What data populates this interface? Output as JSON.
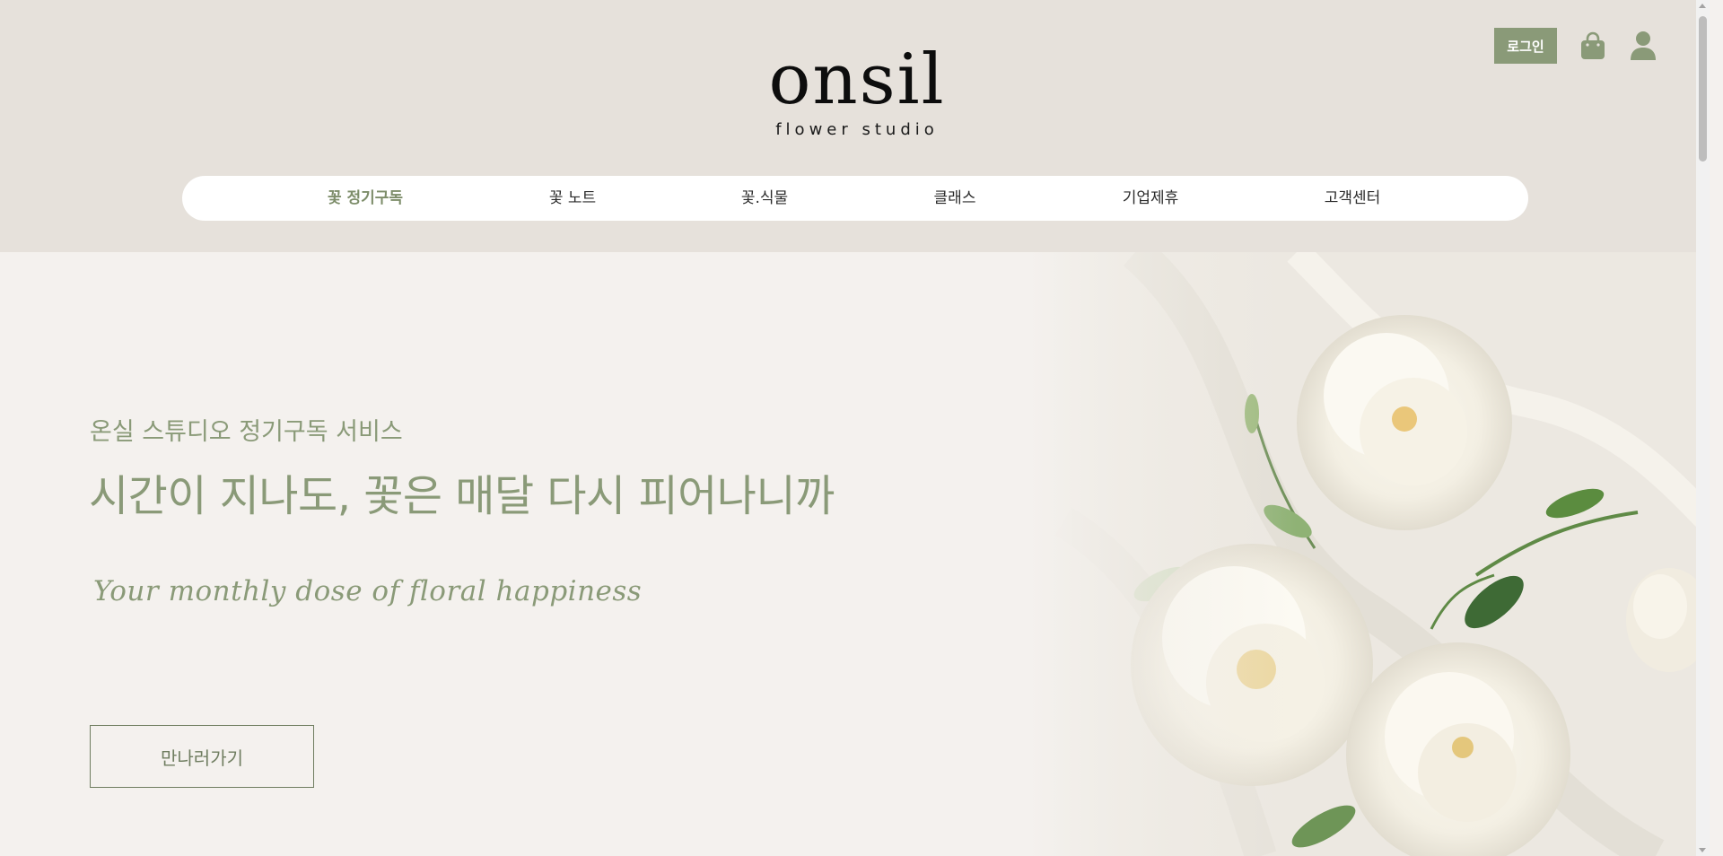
{
  "header": {
    "logo": {
      "word": "onsil",
      "subtitle": "flower studio"
    },
    "login_label": "로그인",
    "cart_icon": "shopping-bag-icon",
    "account_icon": "user-icon"
  },
  "nav": {
    "items": [
      {
        "label": "꽃 정기구독",
        "active": true
      },
      {
        "label": "꽃 노트"
      },
      {
        "label": "꽃.식물"
      },
      {
        "label": "클래스"
      },
      {
        "label": "기업제휴"
      },
      {
        "label": "고객센터"
      }
    ]
  },
  "hero": {
    "eyebrow": "온실 스튜디오 정기구독 서비스",
    "title": "시간이 지나도, 꽃은 매달 다시 피어나니까",
    "script": "Your monthly dose of floral happiness",
    "cta_label": "만나러가기",
    "image": "white-peony-bouquet-on-cream-fabric"
  },
  "colors": {
    "header_bg": "#e6e1db",
    "hero_bg": "#f4f1ee",
    "accent": "#8a9a78",
    "accent_dark": "#6f7d60"
  }
}
